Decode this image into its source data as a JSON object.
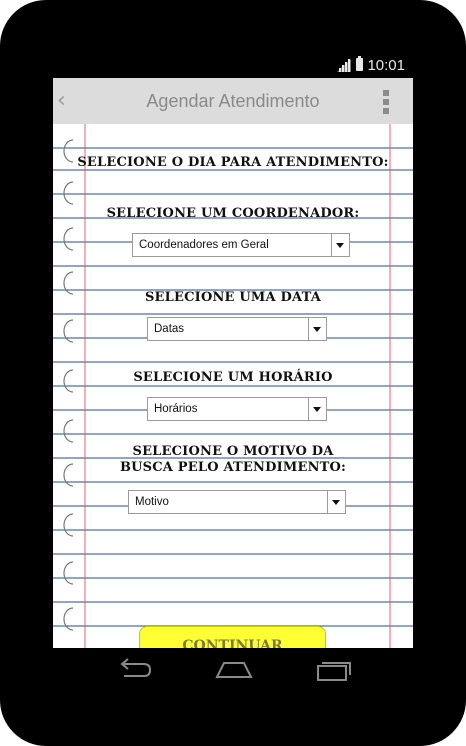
{
  "status_bar": {
    "time": "10:01"
  },
  "action_bar": {
    "title": "Agendar Atendimento"
  },
  "form": {
    "heading": "Selecione o dia para atendimento:",
    "coordinator_label": "Selecione um coordenador:",
    "coordinator_value": "Coordenadores em Geral",
    "date_label": "Selecione uma data",
    "date_value": "Datas",
    "time_label": "Selecione um horário",
    "time_value": "Horários",
    "reason_label_line1": "Selecione o motivo da",
    "reason_label_line2": "busca pelo atendimento:",
    "reason_value": "Motivo",
    "continue_label": "Continuar"
  },
  "colors": {
    "paper_rule": "#1f4e8c",
    "margin_red": "#e06070",
    "button_yellow": "#ffff33",
    "action_bar": "#dcdcdc"
  }
}
